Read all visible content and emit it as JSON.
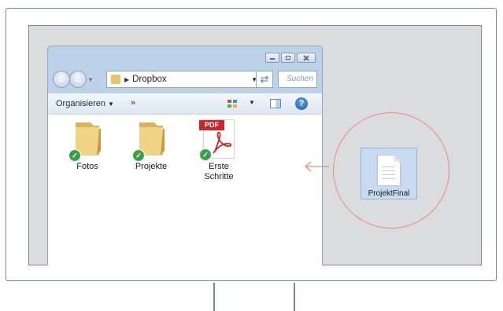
{
  "explorer": {
    "address": "Dropbox",
    "search_placeholder": "Suchen",
    "toolbar": {
      "organize": "Organisieren",
      "more": "»"
    },
    "items": [
      {
        "label": "Fotos",
        "type": "folder",
        "synced": true
      },
      {
        "label": "Projekte",
        "type": "folder",
        "synced": true
      },
      {
        "label": "Erste\nSchritte",
        "type": "pdf",
        "synced": true
      }
    ],
    "pdf_tag": "PDF"
  },
  "dragged_file": {
    "label": "ProjektFinal",
    "type": "document"
  },
  "colors": {
    "accent_circle": "#f08b6f",
    "sync_check": "#3aa14a",
    "pdf_red": "#c9252c",
    "folder": "#e8c66d"
  }
}
